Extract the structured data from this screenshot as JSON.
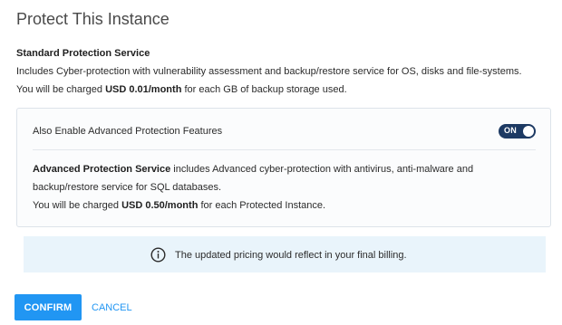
{
  "dialog": {
    "title": "Protect This Instance"
  },
  "standard": {
    "heading": "Standard Protection Service",
    "description": "Includes Cyber-protection with vulnerability assessment and backup/restore service for OS, disks and file-systems.",
    "charge_prefix": "You will be charged ",
    "charge_amount": "USD 0.01/month",
    "charge_suffix": " for each GB of backup storage used."
  },
  "advanced": {
    "toggle_label": "Also Enable Advanced Protection Features",
    "toggle_state": "ON",
    "service_name": "Advanced Protection Service",
    "description_part1": " includes Advanced cyber-protection with antivirus, anti-malware and",
    "description_part2": "backup/restore service for SQL databases.",
    "charge_prefix": "You will be charged ",
    "charge_amount": "USD 0.50/month",
    "charge_suffix": " for each Protected Instance."
  },
  "notice": {
    "icon": "info-icon",
    "text": "The updated pricing would reflect in your final billing."
  },
  "actions": {
    "confirm_label": "CONFIRM",
    "cancel_label": "CANCEL"
  },
  "colors": {
    "primary": "#2196f3",
    "toggle_on": "#1d3a63",
    "notice_bg": "#e9f4fb"
  }
}
